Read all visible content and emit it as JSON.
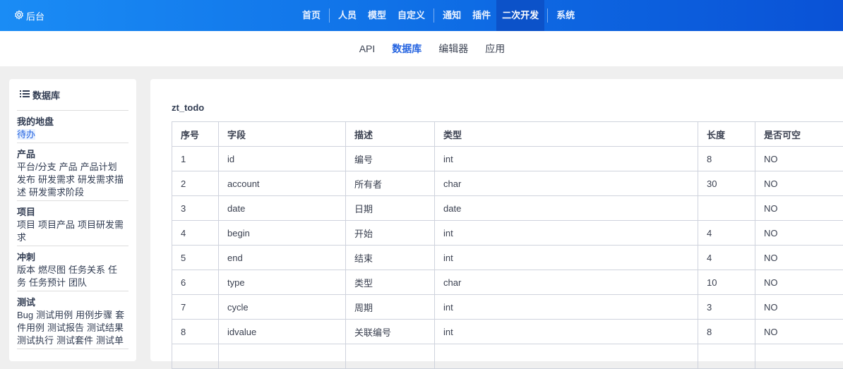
{
  "topbar": {
    "brand": "后台",
    "nav": [
      "首页",
      "人员",
      "模型",
      "自定义",
      "通知",
      "插件",
      "二次开发",
      "系统"
    ],
    "active": "二次开发"
  },
  "subnav": {
    "items": [
      "API",
      "数据库",
      "编辑器",
      "应用"
    ],
    "active": "数据库"
  },
  "sidebar": {
    "title": "数据库",
    "groups": [
      {
        "title": "我的地盘",
        "links": [
          "待办"
        ]
      },
      {
        "title": "产品",
        "links": [
          "平台/分支",
          "产品",
          "产品计划",
          "发布",
          "研发需求",
          "研发需求描述",
          "研发需求阶段"
        ]
      },
      {
        "title": "项目",
        "links": [
          "项目",
          "项目产品",
          "项目研发需求"
        ]
      },
      {
        "title": "冲刺",
        "links": [
          "版本",
          "燃尽图",
          "任务关系",
          "任务",
          "任务预计",
          "团队"
        ]
      },
      {
        "title": "测试",
        "links": [
          "Bug",
          "测试用例",
          "用例步骤",
          "套件用例",
          "测试报告",
          "测试结果",
          "测试执行",
          "测试套件",
          "测试单"
        ]
      }
    ]
  },
  "table": {
    "name": "zt_todo",
    "headers": [
      "序号",
      "字段",
      "描述",
      "类型",
      "长度",
      "是否可空"
    ],
    "rows": [
      [
        "1",
        "id",
        "编号",
        "int",
        "8",
        "NO"
      ],
      [
        "2",
        "account",
        "所有者",
        "char",
        "30",
        "NO"
      ],
      [
        "3",
        "date",
        "日期",
        "date",
        "",
        "NO"
      ],
      [
        "4",
        "begin",
        "开始",
        "int",
        "4",
        "NO"
      ],
      [
        "5",
        "end",
        "结束",
        "int",
        "4",
        "NO"
      ],
      [
        "6",
        "type",
        "类型",
        "char",
        "10",
        "NO"
      ],
      [
        "7",
        "cycle",
        "周期",
        "int",
        "3",
        "NO"
      ],
      [
        "8",
        "idvalue",
        "关联编号",
        "int",
        "8",
        "NO"
      ],
      [
        "",
        "",
        "",
        "",
        "",
        ""
      ]
    ]
  }
}
